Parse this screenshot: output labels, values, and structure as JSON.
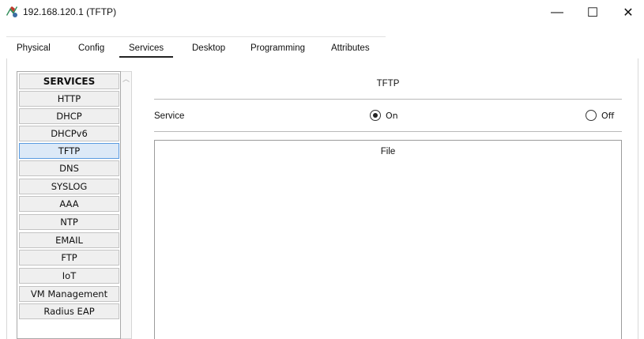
{
  "window": {
    "title": "192.168.120.1 (TFTP)",
    "icon": "router-icon",
    "controls": {
      "minimize": "—",
      "maximize": "☐",
      "close": "✕"
    }
  },
  "tabs": [
    {
      "label": "Physical",
      "active": false
    },
    {
      "label": "Config",
      "active": false
    },
    {
      "label": "Services",
      "active": true
    },
    {
      "label": "Desktop",
      "active": false
    },
    {
      "label": "Programming",
      "active": false
    },
    {
      "label": "Attributes",
      "active": false
    }
  ],
  "sidebar": {
    "header": "SERVICES",
    "items": [
      {
        "label": "HTTP"
      },
      {
        "label": "DHCP"
      },
      {
        "label": "DHCPv6"
      },
      {
        "label": "TFTP",
        "selected": true
      },
      {
        "label": "DNS"
      },
      {
        "label": "SYSLOG"
      },
      {
        "label": "AAA"
      },
      {
        "label": "NTP"
      },
      {
        "label": "EMAIL"
      },
      {
        "label": "FTP"
      },
      {
        "label": "IoT"
      },
      {
        "label": "VM Management"
      },
      {
        "label": "Radius EAP"
      }
    ]
  },
  "panel": {
    "title": "TFTP",
    "service_label": "Service",
    "on_label": "On",
    "off_label": "Off",
    "service_state": "On",
    "file_header": "File"
  },
  "colors": {
    "selected_bg": "#dce9f7",
    "selected_border": "#5a9be0",
    "item_bg": "#efefef"
  }
}
